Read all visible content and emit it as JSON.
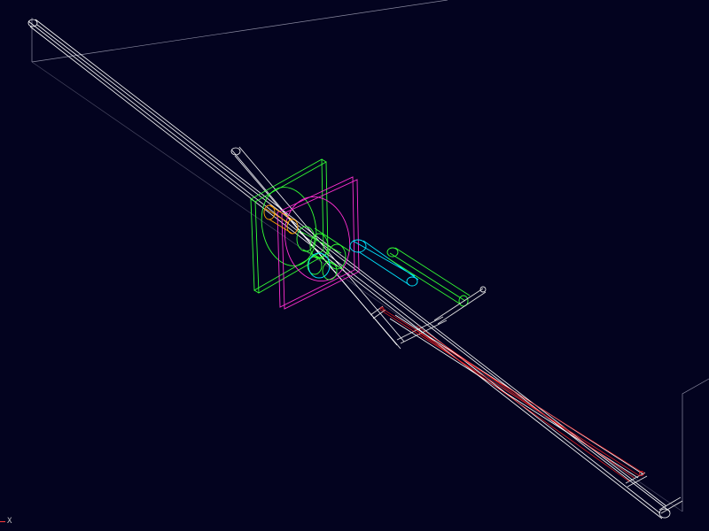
{
  "viewer": {
    "background_color": "#03031f",
    "axis_triad": {
      "label": "X",
      "color": "#ff3b3b"
    }
  },
  "scene": {
    "colors": {
      "bounding_box": "#8a8aa0",
      "beam_pipe": "#ffffff",
      "support_plate": "#33ff33",
      "detector_plate": "#ff2fd0",
      "orange_cylinder": "#ffa400",
      "green_cylinders": "#33ff33",
      "cyan_tube": "#00e8ff",
      "green_arm": "#33ff33",
      "red_cables": "#ff2222",
      "connectors": "#e0e0e0"
    }
  }
}
